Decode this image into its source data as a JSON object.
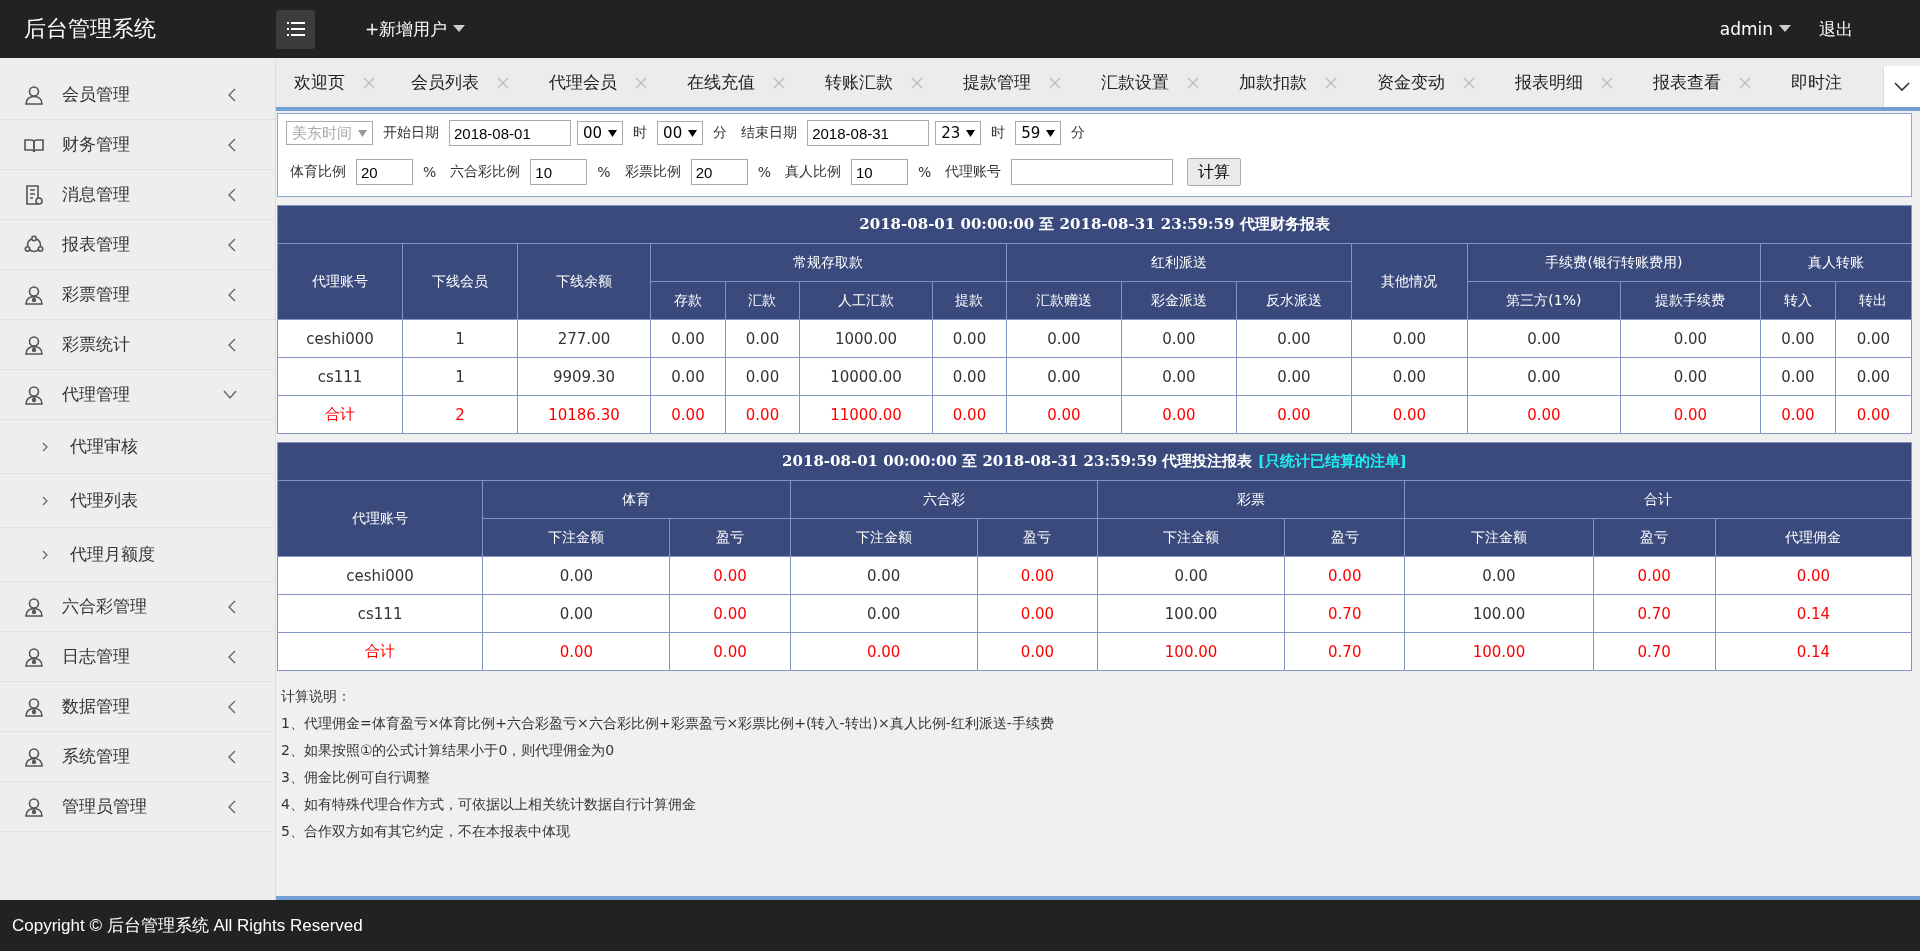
{
  "header": {
    "title": "后台管理系统",
    "add_user": "+新增用户",
    "user": "admin",
    "logout": "退出"
  },
  "sidebar": {
    "items": [
      {
        "label": "会员管理",
        "expanded": false
      },
      {
        "label": "财务管理",
        "expanded": false
      },
      {
        "label": "消息管理",
        "expanded": false
      },
      {
        "label": "报表管理",
        "expanded": false
      },
      {
        "label": "彩票管理",
        "expanded": false
      },
      {
        "label": "彩票统计",
        "expanded": false
      },
      {
        "label": "代理管理",
        "expanded": true,
        "children": [
          {
            "label": "代理审核"
          },
          {
            "label": "代理列表"
          },
          {
            "label": "代理月额度"
          }
        ]
      },
      {
        "label": "六合彩管理",
        "expanded": false
      },
      {
        "label": "日志管理",
        "expanded": false
      },
      {
        "label": "数据管理",
        "expanded": false
      },
      {
        "label": "系统管理",
        "expanded": false
      },
      {
        "label": "管理员管理",
        "expanded": false
      }
    ]
  },
  "tabs": [
    {
      "label": "欢迎页",
      "closable": true
    },
    {
      "label": "会员列表",
      "closable": true
    },
    {
      "label": "代理会员",
      "closable": true
    },
    {
      "label": "在线充值",
      "closable": true
    },
    {
      "label": "转账汇款",
      "closable": true
    },
    {
      "label": "提款管理",
      "closable": true
    },
    {
      "label": "汇款设置",
      "closable": true
    },
    {
      "label": "加款扣款",
      "closable": true
    },
    {
      "label": "资金变动",
      "closable": true
    },
    {
      "label": "报表明细",
      "closable": true
    },
    {
      "label": "报表查看",
      "closable": true
    },
    {
      "label": "即时注",
      "closable": false
    }
  ],
  "filter": {
    "lines": [
      {
        "items": [
          {
            "kind": "select",
            "value": "美东时间",
            "disabled": true
          },
          {
            "kind": "label",
            "text": "开始日期"
          },
          {
            "kind": "date",
            "value": "2018-08-01"
          },
          {
            "kind": "select",
            "value": "00",
            "disabled": false
          },
          {
            "kind": "label",
            "text": "时"
          },
          {
            "kind": "select",
            "value": "00",
            "disabled": false
          },
          {
            "kind": "label",
            "text": "分"
          },
          {
            "kind": "label",
            "text": "结束日期"
          },
          {
            "kind": "date",
            "value": "2018-08-31"
          },
          {
            "kind": "select",
            "value": "23",
            "disabled": false
          },
          {
            "kind": "label",
            "text": "时"
          },
          {
            "kind": "select",
            "value": "59",
            "disabled": false
          },
          {
            "kind": "label",
            "text": "分"
          }
        ]
      },
      {
        "items": [
          {
            "kind": "label",
            "text": "体育比例"
          },
          {
            "kind": "ratio",
            "value": "20"
          },
          {
            "kind": "label",
            "text": "%"
          },
          {
            "kind": "label",
            "text": "六合彩比例"
          },
          {
            "kind": "ratio",
            "value": "10"
          },
          {
            "kind": "label",
            "text": "%"
          },
          {
            "kind": "label",
            "text": "彩票比例"
          },
          {
            "kind": "ratio",
            "value": "20"
          },
          {
            "kind": "label",
            "text": "%"
          },
          {
            "kind": "label",
            "text": "真人比例"
          },
          {
            "kind": "ratio",
            "value": "10"
          },
          {
            "kind": "label",
            "text": "%"
          },
          {
            "kind": "label",
            "text": "代理账号"
          },
          {
            "kind": "text"
          },
          {
            "kind": "button",
            "text": "计算"
          }
        ]
      }
    ]
  },
  "finance_report": {
    "title": "2018-08-01 00:00:00 至 2018-08-31 23:59:59 代理财务报表",
    "columns": [
      {
        "label": "代理账号"
      },
      {
        "label": "下线会员"
      },
      {
        "label": "下线余额"
      },
      {
        "label": "常规存取款",
        "colspan": 4,
        "children": [
          {
            "label": "存款"
          },
          {
            "label": "汇款"
          },
          {
            "label": "人工汇款"
          },
          {
            "label": "提款"
          }
        ]
      },
      {
        "label": "红利派送",
        "colspan": 3,
        "children": [
          {
            "label": "汇款赠送"
          },
          {
            "label": "彩金派送"
          },
          {
            "label": "反水派送"
          }
        ]
      },
      {
        "label": "其他情况"
      },
      {
        "label": "手续费(银行转账费用)",
        "colspan": 2,
        "children": [
          {
            "label": "第三方(1%)"
          },
          {
            "label": "提款手续费"
          }
        ]
      },
      {
        "label": "真人转账",
        "colspan": 2,
        "children": [
          {
            "label": "转入"
          },
          {
            "label": "转出"
          }
        ]
      }
    ],
    "rows": [
      {
        "total": false,
        "cells": [
          "ceshi000",
          "1",
          "277.00",
          "0.00",
          "0.00",
          "1000.00",
          "0.00",
          "0.00",
          "0.00",
          "0.00",
          "0.00",
          "0.00",
          "0.00",
          "0.00",
          "0.00"
        ]
      },
      {
        "total": false,
        "cells": [
          "cs111",
          "1",
          "9909.30",
          "0.00",
          "0.00",
          "10000.00",
          "0.00",
          "0.00",
          "0.00",
          "0.00",
          "0.00",
          "0.00",
          "0.00",
          "0.00",
          "0.00"
        ]
      },
      {
        "total": true,
        "cells": [
          "合计",
          "2",
          "10186.30",
          "0.00",
          "0.00",
          "11000.00",
          "0.00",
          "0.00",
          "0.00",
          "0.00",
          "0.00",
          "0.00",
          "0.00",
          "0.00",
          "0.00"
        ]
      }
    ]
  },
  "bet_report": {
    "title": "2018-08-01 00:00:00 至 2018-08-31 23:59:59 代理投注报表",
    "title_note": "[只统计已结算的注单]",
    "columns": [
      {
        "label": "代理账号"
      },
      {
        "label": "体育",
        "colspan": 2,
        "children": [
          {
            "label": "下注金额",
            "emphasis": false
          },
          {
            "label": "盈亏",
            "emphasis": true
          }
        ]
      },
      {
        "label": "六合彩",
        "colspan": 2,
        "children": [
          {
            "label": "下注金额",
            "emphasis": false
          },
          {
            "label": "盈亏",
            "emphasis": true
          }
        ]
      },
      {
        "label": "彩票",
        "colspan": 2,
        "children": [
          {
            "label": "下注金额",
            "emphasis": false
          },
          {
            "label": "盈亏",
            "emphasis": true
          }
        ]
      },
      {
        "label": "合计",
        "colspan": 3,
        "children": [
          {
            "label": "下注金额",
            "emphasis": false
          },
          {
            "label": "盈亏",
            "emphasis": true
          },
          {
            "label": "代理佣金",
            "emphasis": true
          }
        ]
      }
    ],
    "rows": [
      {
        "total": false,
        "cells": [
          "ceshi000",
          "0.00",
          "0.00",
          "0.00",
          "0.00",
          "0.00",
          "0.00",
          "0.00",
          "0.00",
          "0.00"
        ]
      },
      {
        "total": false,
        "cells": [
          "cs111",
          "0.00",
          "0.00",
          "0.00",
          "0.00",
          "100.00",
          "0.70",
          "100.00",
          "0.70",
          "0.14"
        ]
      },
      {
        "total": true,
        "cells": [
          "合计",
          "0.00",
          "0.00",
          "0.00",
          "0.00",
          "100.00",
          "0.70",
          "100.00",
          "0.70",
          "0.14"
        ]
      }
    ]
  },
  "notes": {
    "title": "计算说明：",
    "lines": [
      "1、代理佣金=体育盈亏×体育比例+六合彩盈亏×六合彩比例+彩票盈亏×彩票比例+(转入-转出)×真人比例-红利派送-手续费",
      "2、如果按照①的公式计算结果小于0，则代理佣金为0",
      "3、佣金比例可自行调整",
      "4、如有特殊代理合作方式，可依据以上相关统计数据自行计算佣金",
      "5、合作双方如有其它约定，不在本报表中体现"
    ]
  },
  "footer": "Copyright © 后台管理系统 All Rights Reserved"
}
